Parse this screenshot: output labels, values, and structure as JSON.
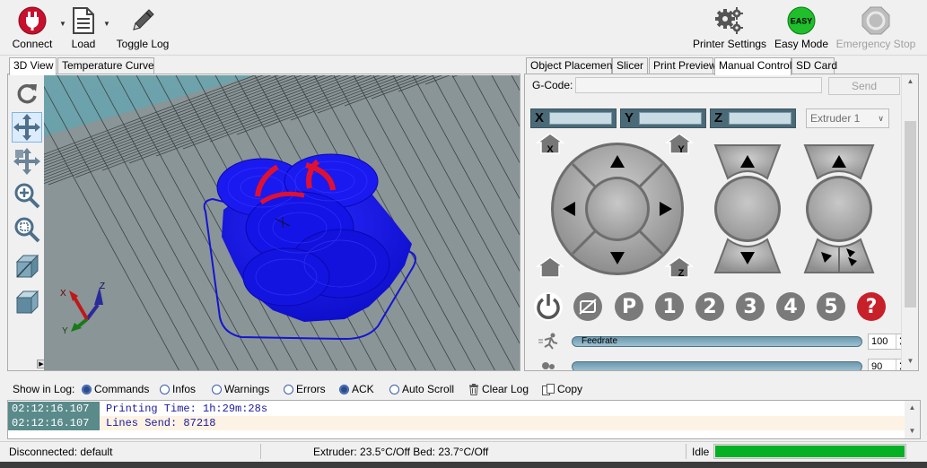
{
  "toolbar": {
    "connect_label": "Connect",
    "load_label": "Load",
    "toggle_log_label": "Toggle Log",
    "printer_settings_label": "Printer Settings",
    "easy_mode_label": "Easy Mode",
    "easy_badge": "EASY",
    "emergency_stop_label": "Emergency Stop"
  },
  "left_tabs": [
    "3D View",
    "Temperature Curve"
  ],
  "right_tabs": [
    "Object Placement",
    "Slicer",
    "Print Preview",
    "Manual Control",
    "SD Card"
  ],
  "manual_control": {
    "gcode_label": "G-Code:",
    "gcode_value": "",
    "send_label": "Send",
    "axes": [
      "X",
      "Y",
      "Z"
    ],
    "extruder_selected": "Extruder 1",
    "home_labels": [
      "X",
      "Y",
      "Z"
    ],
    "number_buttons": [
      "1",
      "2",
      "3",
      "4",
      "5"
    ],
    "p_button": "P",
    "help_button": "?",
    "feedrate_label": "Feedrate",
    "feedrate_value": "100",
    "flowrate_value": "90"
  },
  "log_bar": {
    "show_in_log": "Show in Log:",
    "filters": [
      {
        "label": "Commands",
        "on": true
      },
      {
        "label": "Infos",
        "on": false
      },
      {
        "label": "Warnings",
        "on": false
      },
      {
        "label": "Errors",
        "on": false
      },
      {
        "label": "ACK",
        "on": true
      },
      {
        "label": "Auto Scroll",
        "on": false
      }
    ],
    "clear_log": "Clear Log",
    "copy": "Copy"
  },
  "log": [
    {
      "time": "02:12:16.107",
      "msg": "Printing Time: 1h:29m:28s"
    },
    {
      "time": "02:12:16.107",
      "msg": "Lines Send: 87218"
    }
  ],
  "status": {
    "connection": "Disconnected: default",
    "temps": "Extruder: 23.5°C/Off Bed: 23.7°C/Off",
    "state": "Idle",
    "progress": 1.0
  },
  "colors": {
    "accent_green": "#06b025",
    "model_blue": "#1010e0",
    "highlight_red": "#e01030",
    "panel_teal": "#4a6a78"
  }
}
